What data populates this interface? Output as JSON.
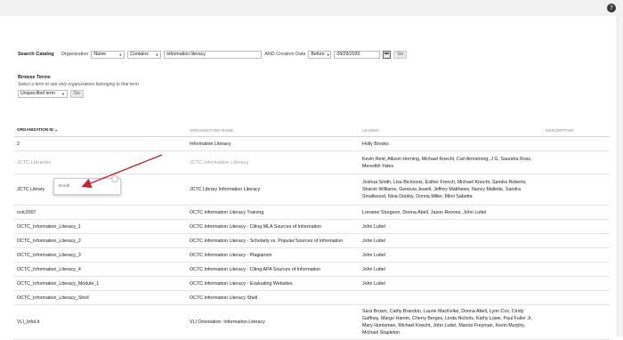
{
  "help_icon": "?",
  "search": {
    "title": "Search Catalog",
    "field_label": "Organization",
    "field_value": "Name",
    "operator_value": "Contains",
    "query_value": "information literacy",
    "date_label": "AND Creation Date",
    "date_operator": "Before",
    "date_value": "09/29/2020",
    "go_label": "Go"
  },
  "browse": {
    "title": "Browse Terms",
    "hint": "Select a term to see only organizations belonging to that term",
    "term_value": "Unspecified term",
    "go_label": "Go"
  },
  "table": {
    "headers": [
      "ORGANIZATION ID",
      "ORGANIZATION NAME",
      "LEADER",
      "DESCRIPTION"
    ],
    "sort_indicator": "⌄",
    "rows": [
      {
        "id": "2",
        "name": "Information Literacy",
        "leader": "Holly Brooks"
      },
      {
        "id": "JCTC Libraries",
        "name": "JCTC Information Literacy",
        "leader": "Kevin Reid, Allison Horning, Michael Knecht, Carl Armstrong, J G, Saundra Ross, Meredith Yates"
      },
      {
        "id": "JCTC Library",
        "name": "JCTC Library Information Literacy",
        "leader": "Joshua Smith, Lisa Bichinotz, Esther French, Michael Knecht, Sandra Roberts, Sharon Williams, Genevia Jewell, Jeffrey Matthews, Nancy Mallette, Sandra Smallwood, Nina Dooley, Donna Miller, Mimi Sabetta"
      },
      {
        "id": "octc2007",
        "name": "OCTC Information Literacy Training",
        "leader": "Lorraine Sturgeon, Donna Abell, Jason Reeves, John Luttel"
      },
      {
        "id": "OCTC_Information_Literacy_1",
        "name": "OCTC Information Literacy - Citing MLA Sources of Information",
        "leader": "John Luttel"
      },
      {
        "id": "OCTC_Information_Literacy_2",
        "name": "OCTC Information Literacy - Scholarly vs. Popular Sources of Information",
        "leader": "John Luttel"
      },
      {
        "id": "OCTC_Information_Literacy_3",
        "name": "OCTC Information Literacy - Plagiarism",
        "leader": "John Luttel"
      },
      {
        "id": "OCTC_Information_Literacy_4",
        "name": "OCTC Information Literacy - Citing APA Sources of Information",
        "leader": "John Luttel"
      },
      {
        "id": "OCTC_Information_Literacy_Module_1",
        "name": "OCTC Information Literacy - Evaluating Websites",
        "leader": "John Luttel"
      },
      {
        "id": "OCTC_Information_Literacy_Shell",
        "name": "OCTC Information Literacy Shell",
        "leader": ""
      },
      {
        "id": "VLI_InfoLit",
        "name": "VLI Orientation: Information Literacy",
        "leader": "Sara Brown, Cathy Brandon, Laurie MacKellar, Donna Abell, Lynn Cox, Cindy Gaffney, Margo Hamm, Cherry Berges, Linda Nichols, Kathy Lowe, Paul Fuller Jr, Mary Huntsman, Michael Knecht, John Luttel, Marcia Freyman, Kevin Murphy, Michael Stapleton"
      }
    ]
  },
  "popup": {
    "text": "Enroll"
  },
  "colors": {
    "arrow": "#c0282d",
    "topbar": "#f1f1f1"
  }
}
